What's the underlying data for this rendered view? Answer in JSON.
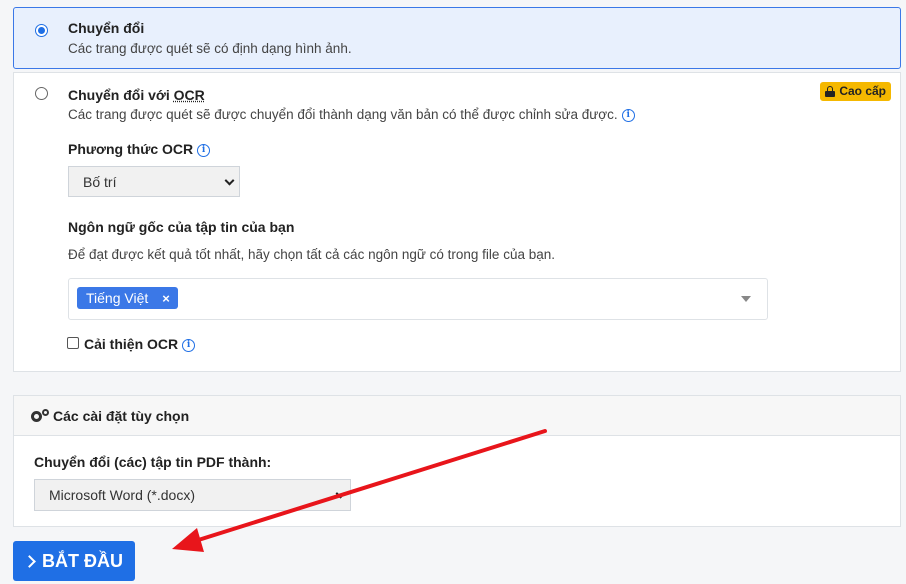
{
  "option_convert": {
    "title": "Chuyển đổi",
    "description": "Các trang được quét sẽ có định dạng hình ảnh.",
    "selected": true
  },
  "option_ocr": {
    "title_prefix": "Chuyển đổi với ",
    "title_abbr": "OCR",
    "description": "Các trang được quét sẽ được chuyển đổi thành dạng văn bản có thể được chỉnh sửa được.",
    "badge": "Cao cấp",
    "ocr_method_label": "Phương thức OCR",
    "ocr_method_value": "Bố trí",
    "language_label": "Ngôn ngữ gốc của tập tin của bạn",
    "language_help": "Để đạt được kết quả tốt nhất, hãy chọn tất cả các ngôn ngữ có trong file của bạn.",
    "selected_language": "Tiếng Việt",
    "tag_remove": "×",
    "improve_ocr_label": "Cải thiện OCR",
    "improve_ocr_checked": false
  },
  "settings": {
    "header": "Các cài đặt tùy chọn",
    "convert_label": "Chuyển đổi (các) tập tin PDF thành:",
    "convert_value": "Microsoft Word (*.docx)"
  },
  "start_button": {
    "label": "BẮT ĐẦU"
  },
  "colors": {
    "primary": "#1f6fe5",
    "badge": "#f5b800",
    "annotation_arrow": "#e8151b"
  },
  "icons": {
    "info": "info-icon",
    "lock": "lock-icon",
    "gears": "gears-icon",
    "chevron_right": "chevron-right-icon"
  }
}
